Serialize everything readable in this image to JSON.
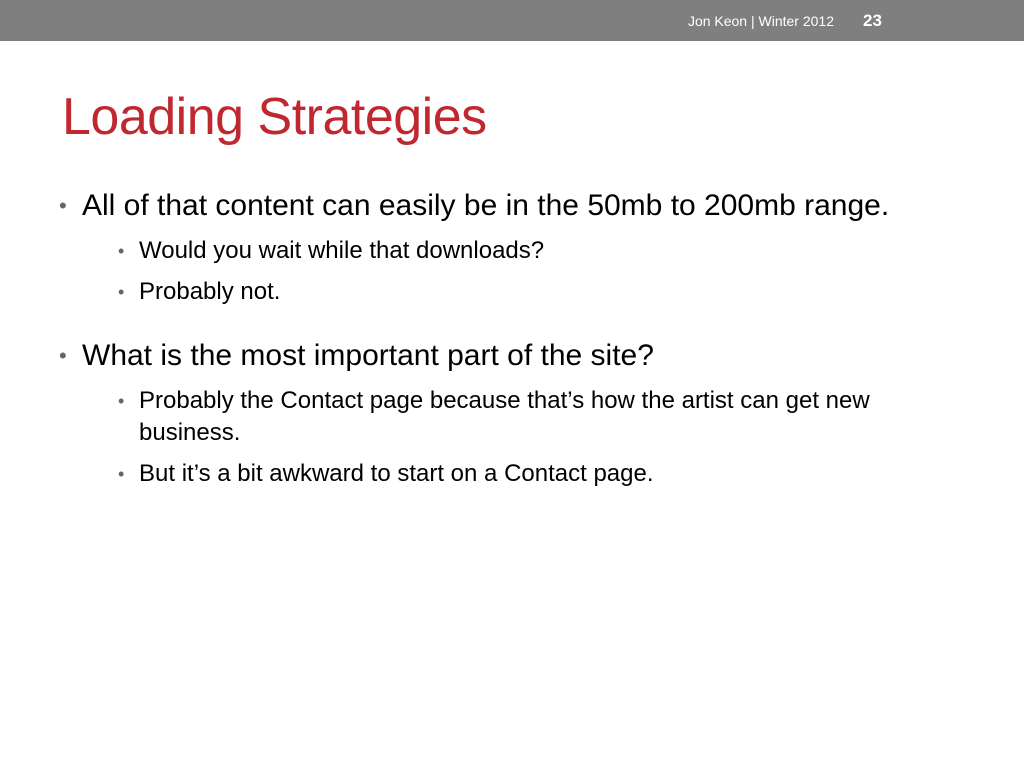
{
  "header": {
    "footer_text": "Jon Keon | Winter 2012",
    "slide_number": "23"
  },
  "title": "Loading Strategies",
  "bullets": [
    {
      "text": "All of that content can easily be in the 50mb to 200mb range.",
      "sub": [
        "Would you wait while that downloads?",
        "Probably not."
      ]
    },
    {
      "text": "What is the most important part of the site?",
      "sub": [
        "Probably the Contact page because that’s how the artist can get new business.",
        "But it’s a bit awkward to start on a Contact page."
      ]
    }
  ],
  "bullet_glyph": "•",
  "colors": {
    "topbar": "#7f7f7f",
    "title": "#c0282f",
    "bullet": "#666666"
  }
}
